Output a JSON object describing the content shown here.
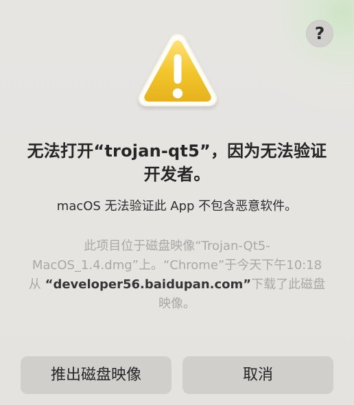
{
  "dialog": {
    "help_label": "?",
    "title_prefix": "无法打开",
    "title_name": "“trojan-qt5”",
    "title_suffix": "，因为无法验证开发者。",
    "subtitle": "macOS 无法验证此 App 不包含恶意软件。",
    "info_before": "此项目位于磁盘映像“Trojan-Qt5-MacOS_1.4.dmg”上。“Chrome”于今天下午10:18 从",
    "info_source": "“developer56.baidupan.com”",
    "info_after": "下载了此磁盘映像。",
    "eject_button": "推出磁盘映像",
    "cancel_button": "取消"
  },
  "icons": {
    "help": "question-mark-icon",
    "warning": "warning-triangle-icon"
  },
  "colors": {
    "background": "#e6e4e1",
    "button": "#d0cfcc",
    "warning_fill": "#f1c52e",
    "warning_border": "#fffdf4",
    "warning_symbol": "#ffffff",
    "muted_text": "#a9a8a6",
    "primary_text": "#252525"
  }
}
